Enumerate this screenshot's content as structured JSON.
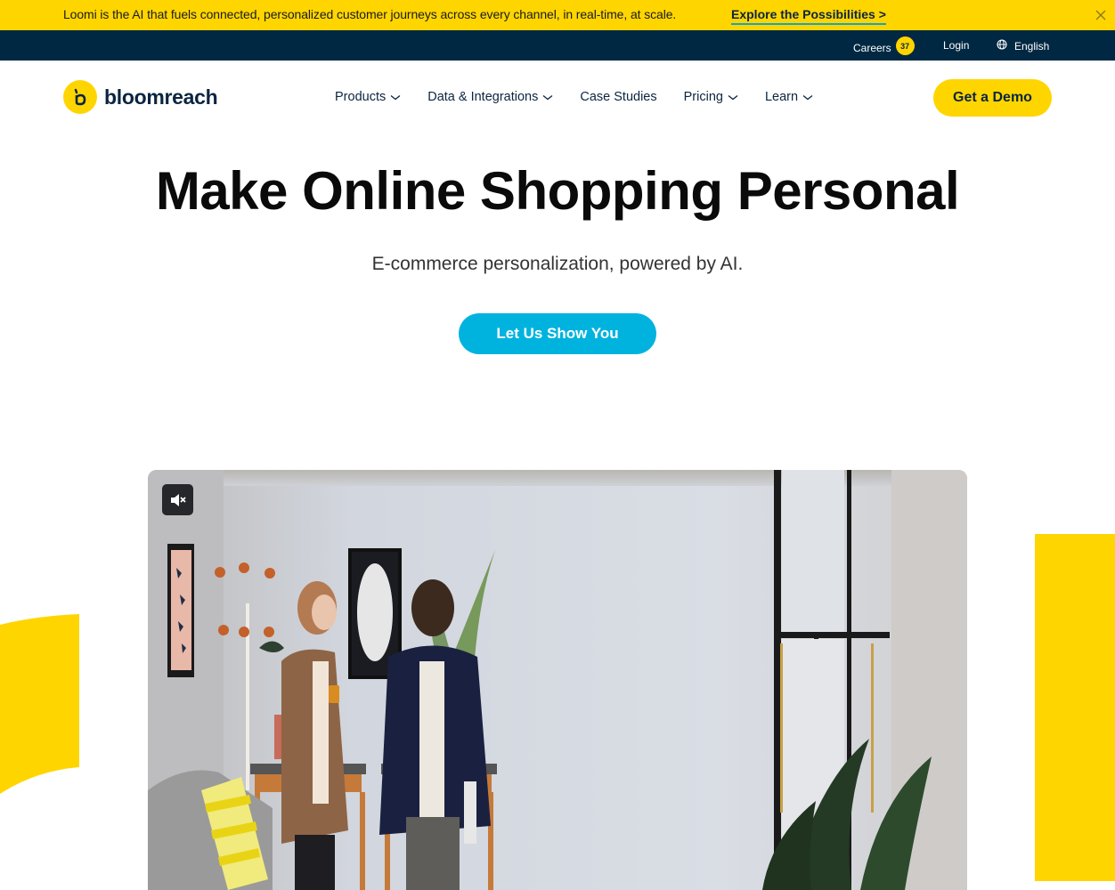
{
  "announcement": {
    "text": "Loomi is the AI that fuels connected, personalized customer journeys across every channel, in real-time, at scale.",
    "link_label": "Explore the Possibilities >",
    "close_icon": "close-icon"
  },
  "utility_nav": {
    "careers_label": "Careers",
    "careers_count": "37",
    "login_label": "Login",
    "language_label": "English",
    "language_icon": "globe-icon"
  },
  "brand": {
    "name": "bloomreach",
    "logo_icon": "bloomreach-b-icon"
  },
  "main_nav": {
    "items": [
      {
        "label": "Products",
        "has_dropdown": true
      },
      {
        "label": "Data & Integrations",
        "has_dropdown": true
      },
      {
        "label": "Case Studies",
        "has_dropdown": false
      },
      {
        "label": "Pricing",
        "has_dropdown": true
      },
      {
        "label": "Learn",
        "has_dropdown": true
      }
    ],
    "cta_label": "Get a Demo"
  },
  "hero": {
    "title": "Make Online Shopping Personal",
    "subtitle": "E-commerce personalization, powered by AI.",
    "cta_label": "Let Us Show You"
  },
  "video": {
    "mute_icon": "volume-muted-icon",
    "description": "Two people walking and talking in a bright office lounge"
  },
  "colors": {
    "brand_yellow": "#ffd500",
    "navy": "#002842",
    "text_dark": "#0b2540",
    "cta_blue": "#00b3de",
    "link_underline": "#13a3c9"
  }
}
